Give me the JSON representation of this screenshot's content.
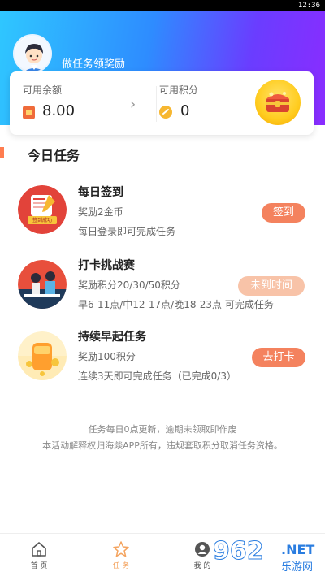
{
  "status_bar": {
    "time": "12:36"
  },
  "header": {
    "title": "做任务领奖励"
  },
  "balance_card": {
    "balance_label": "可用余额",
    "balance_value": "8.00",
    "points_label": "可用积分",
    "points_value": "0",
    "chevron": "›"
  },
  "section": {
    "title": "今日任务"
  },
  "tasks": [
    {
      "name": "每日签到",
      "reward": "奖励2金币",
      "desc": "每日登录即可完成任务",
      "button": "签到",
      "image_text": "签到成功",
      "button_color": "#f4825e"
    },
    {
      "name": "打卡挑战赛",
      "reward": "奖励积分20/30/50积分",
      "desc": "早6-11点/中12-17点/晚18-23点 可完成任务",
      "button": "未到时间",
      "button_color": "#f8c3a8"
    },
    {
      "name": "持续早起任务",
      "reward": "奖励100积分",
      "desc": "连续3天即可完成任务（已完成0/3）",
      "button": "去打卡",
      "button_color": "#f4825e"
    }
  ],
  "notice": {
    "line1": "任务每日0点更新，逾期未领取即作废",
    "line2": "本活动解释权归海燚APP所有，违规套取积分取消任务资格。"
  },
  "tabbar": {
    "tabs": [
      {
        "label": "首 页",
        "icon": "home-icon"
      },
      {
        "label": "任 务",
        "icon": "star-icon",
        "active": true
      },
      {
        "label": "我 的",
        "icon": "user-icon"
      }
    ],
    "active_color": "#f4a35e"
  },
  "watermark": {
    "number": "962",
    "domain": ".NET",
    "cn": "乐游网"
  }
}
